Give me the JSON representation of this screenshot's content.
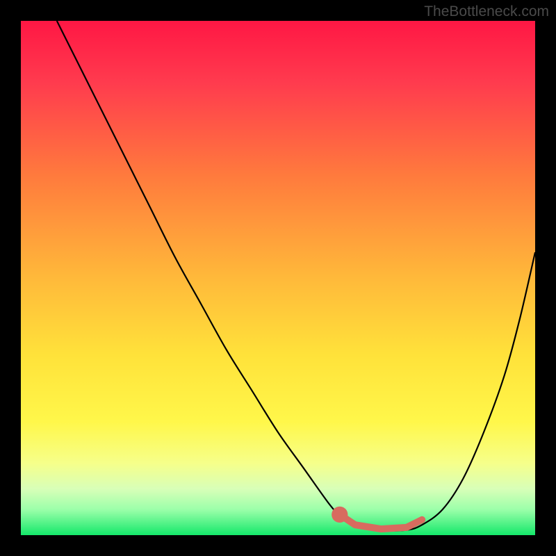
{
  "watermark": "TheBottleneck.com",
  "colors": {
    "curve": "#000000",
    "marker": "#d86b5f",
    "gradient_top": "#ff1744",
    "gradient_bottom": "#14e86a",
    "page_bg": "#000000",
    "watermark_text": "#4a4a4a"
  },
  "chart_data": {
    "type": "line",
    "title": "",
    "xlabel": "",
    "ylabel": "",
    "xlim": [
      0,
      100
    ],
    "ylim": [
      0,
      100
    ],
    "series": [
      {
        "name": "bottleneck-curve",
        "x": [
          7,
          10,
          15,
          20,
          25,
          30,
          35,
          40,
          45,
          50,
          55,
          60,
          62,
          65,
          70,
          75,
          78,
          82,
          86,
          90,
          94,
          97,
          100
        ],
        "y": [
          100,
          94,
          84,
          74,
          64,
          54,
          45,
          36,
          28,
          20,
          13,
          6,
          4,
          2,
          1,
          1,
          2,
          5,
          11,
          20,
          31,
          42,
          55
        ]
      },
      {
        "name": "optimal-range",
        "x": [
          62,
          65,
          70,
          75,
          78
        ],
        "y": [
          4,
          2,
          1.2,
          1.5,
          3
        ]
      }
    ],
    "optimal_point": {
      "x": 62,
      "y": 4,
      "r": 0.9
    },
    "annotations": []
  }
}
